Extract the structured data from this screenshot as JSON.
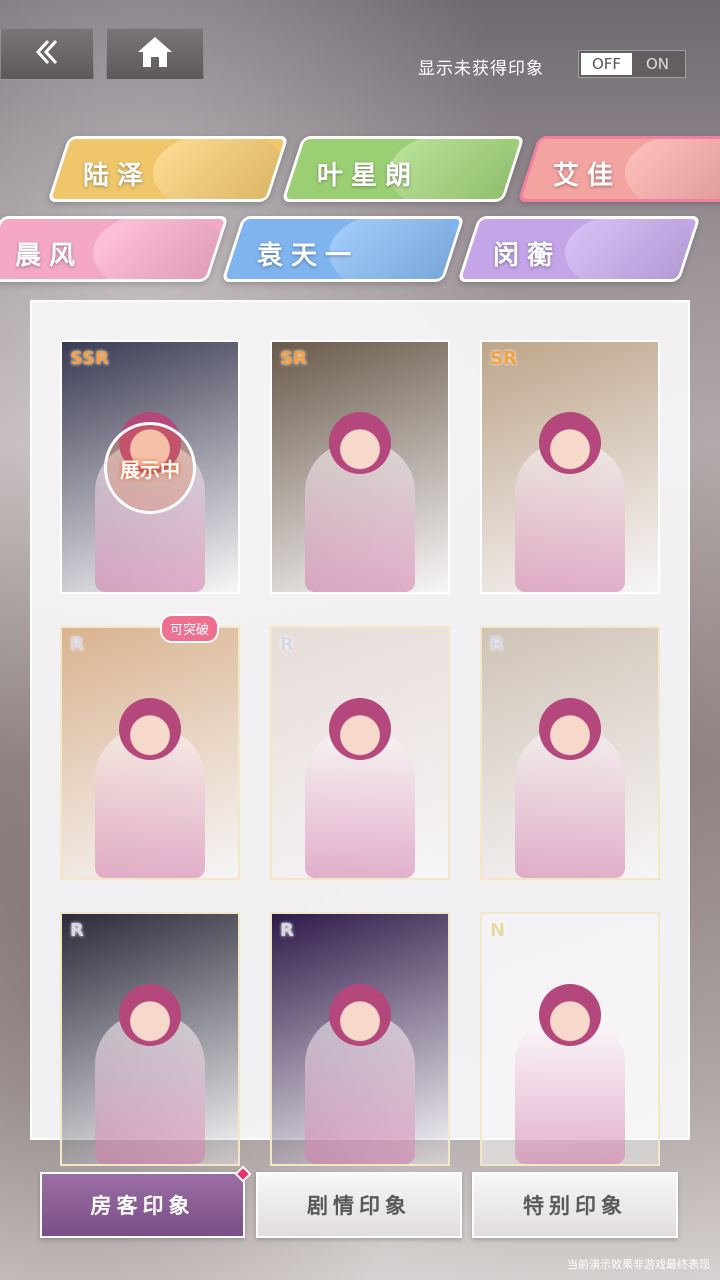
{
  "header": {
    "back_icon": "double-chevron-left-icon",
    "home_icon": "home-icon",
    "toggle_label": "显示未获得印象",
    "toggle_off": "OFF",
    "toggle_on": "ON",
    "toggle_state": "OFF"
  },
  "characters": [
    {
      "name": "陆泽",
      "color": "#f0c66b"
    },
    {
      "name": "叶星朗",
      "color": "#9ccf73"
    },
    {
      "name": "艾佳",
      "color": "#f3a3a0",
      "active": true
    },
    {
      "name": "晨风",
      "color": "#f5a8c6"
    },
    {
      "name": "袁天一",
      "color": "#7fb4ee"
    },
    {
      "name": "闵蘅",
      "color": "#c3a5e8"
    }
  ],
  "cards": [
    {
      "rarity": "SSR",
      "overlay": "展示中",
      "bg": "#3a3a52"
    },
    {
      "rarity": "SR",
      "bg": "#6a5a4a"
    },
    {
      "rarity": "SR",
      "bg": "#bda58a"
    },
    {
      "rarity": "R",
      "badge": "可突破",
      "bg": "#d9b38f"
    },
    {
      "rarity": "R",
      "bg": "#e6dcd8"
    },
    {
      "rarity": "R",
      "bg": "#cfc3b6"
    },
    {
      "rarity": "R",
      "bg": "#2a2a3a"
    },
    {
      "rarity": "R",
      "bg": "#2e1a48"
    },
    {
      "rarity": "N",
      "bg": "#f4f2f4"
    }
  ],
  "bottom_tabs": [
    {
      "label": "房客印象",
      "active": true
    },
    {
      "label": "剧情印象"
    },
    {
      "label": "特别印象"
    }
  ],
  "disclaimer": "当前演示效果非游戏最终表现"
}
